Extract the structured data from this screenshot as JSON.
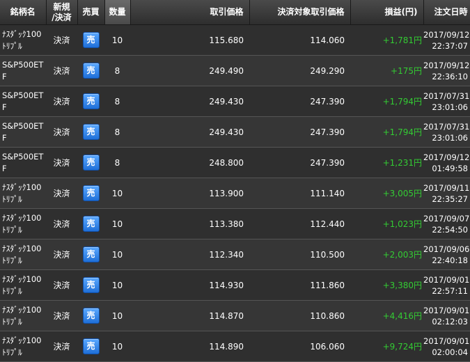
{
  "headers": {
    "symbol": "銘柄名",
    "kind": "新規\n/決済",
    "side": "売買",
    "qty": "数量",
    "price": "取引価格",
    "close_price": "決済対象取引価格",
    "pl": "損益(円)",
    "datetime": "注文日時"
  },
  "rows": [
    {
      "symbol_l1": "ﾅｽﾀﾞｯｸ100",
      "symbol_l2": "ﾄﾘﾌﾟﾙ",
      "kind": "決済",
      "side": "売",
      "qty": "10",
      "price": "115.680",
      "close_price": "114.060",
      "pl": "+1,781円",
      "date": "2017/09/12",
      "time": "22:37:07"
    },
    {
      "symbol_l1": "S&P500ET",
      "symbol_l2": "F",
      "kind": "決済",
      "side": "売",
      "qty": "8",
      "price": "249.490",
      "close_price": "249.290",
      "pl": "+175円",
      "date": "2017/09/12",
      "time": "22:36:10"
    },
    {
      "symbol_l1": "S&P500ET",
      "symbol_l2": "F",
      "kind": "決済",
      "side": "売",
      "qty": "8",
      "price": "249.430",
      "close_price": "247.390",
      "pl": "+1,794円",
      "date": "2017/07/31",
      "time": "23:01:06"
    },
    {
      "symbol_l1": "S&P500ET",
      "symbol_l2": "F",
      "kind": "決済",
      "side": "売",
      "qty": "8",
      "price": "249.430",
      "close_price": "247.390",
      "pl": "+1,794円",
      "date": "2017/07/31",
      "time": "23:01:06"
    },
    {
      "symbol_l1": "S&P500ET",
      "symbol_l2": "F",
      "kind": "決済",
      "side": "売",
      "qty": "8",
      "price": "248.800",
      "close_price": "247.390",
      "pl": "+1,231円",
      "date": "2017/09/12",
      "time": "01:49:58"
    },
    {
      "symbol_l1": "ﾅｽﾀﾞｯｸ100",
      "symbol_l2": "ﾄﾘﾌﾟﾙ",
      "kind": "決済",
      "side": "売",
      "qty": "10",
      "price": "113.900",
      "close_price": "111.140",
      "pl": "+3,005円",
      "date": "2017/09/11",
      "time": "22:35:27"
    },
    {
      "symbol_l1": "ﾅｽﾀﾞｯｸ100",
      "symbol_l2": "ﾄﾘﾌﾟﾙ",
      "kind": "決済",
      "side": "売",
      "qty": "10",
      "price": "113.380",
      "close_price": "112.440",
      "pl": "+1,023円",
      "date": "2017/09/07",
      "time": "22:54:50"
    },
    {
      "symbol_l1": "ﾅｽﾀﾞｯｸ100",
      "symbol_l2": "ﾄﾘﾌﾟﾙ",
      "kind": "決済",
      "side": "売",
      "qty": "10",
      "price": "112.340",
      "close_price": "110.500",
      "pl": "+2,003円",
      "date": "2017/09/06",
      "time": "22:40:18"
    },
    {
      "symbol_l1": "ﾅｽﾀﾞｯｸ100",
      "symbol_l2": "ﾄﾘﾌﾟﾙ",
      "kind": "決済",
      "side": "売",
      "qty": "10",
      "price": "114.930",
      "close_price": "111.860",
      "pl": "+3,380円",
      "date": "2017/09/01",
      "time": "22:57:11"
    },
    {
      "symbol_l1": "ﾅｽﾀﾞｯｸ100",
      "symbol_l2": "ﾄﾘﾌﾟﾙ",
      "kind": "決済",
      "side": "売",
      "qty": "10",
      "price": "114.870",
      "close_price": "110.860",
      "pl": "+4,416円",
      "date": "2017/09/01",
      "time": "02:12:03"
    },
    {
      "symbol_l1": "ﾅｽﾀﾞｯｸ100",
      "symbol_l2": "ﾄﾘﾌﾟﾙ",
      "kind": "決済",
      "side": "売",
      "qty": "10",
      "price": "114.890",
      "close_price": "106.060",
      "pl": "+9,724円",
      "date": "2017/09/01",
      "time": "02:00:04"
    }
  ],
  "colors": {
    "profit": "#33cc33",
    "sell_button": "#1f6fd8",
    "background": "#2b2b2b"
  }
}
